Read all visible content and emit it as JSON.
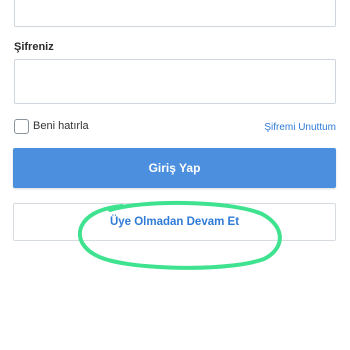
{
  "form": {
    "password_label": "Şifreniz",
    "remember_label": "Beni hatırla",
    "forgot_link": "Şifremi Unuttum",
    "login_button": "Giriş Yap",
    "guest_button": "Üye Olmadan Devam Et",
    "remember_checked": false
  },
  "colors": {
    "primary": "#4b8fde",
    "link": "#2f7bd8",
    "highlight": "#3ee28f"
  }
}
